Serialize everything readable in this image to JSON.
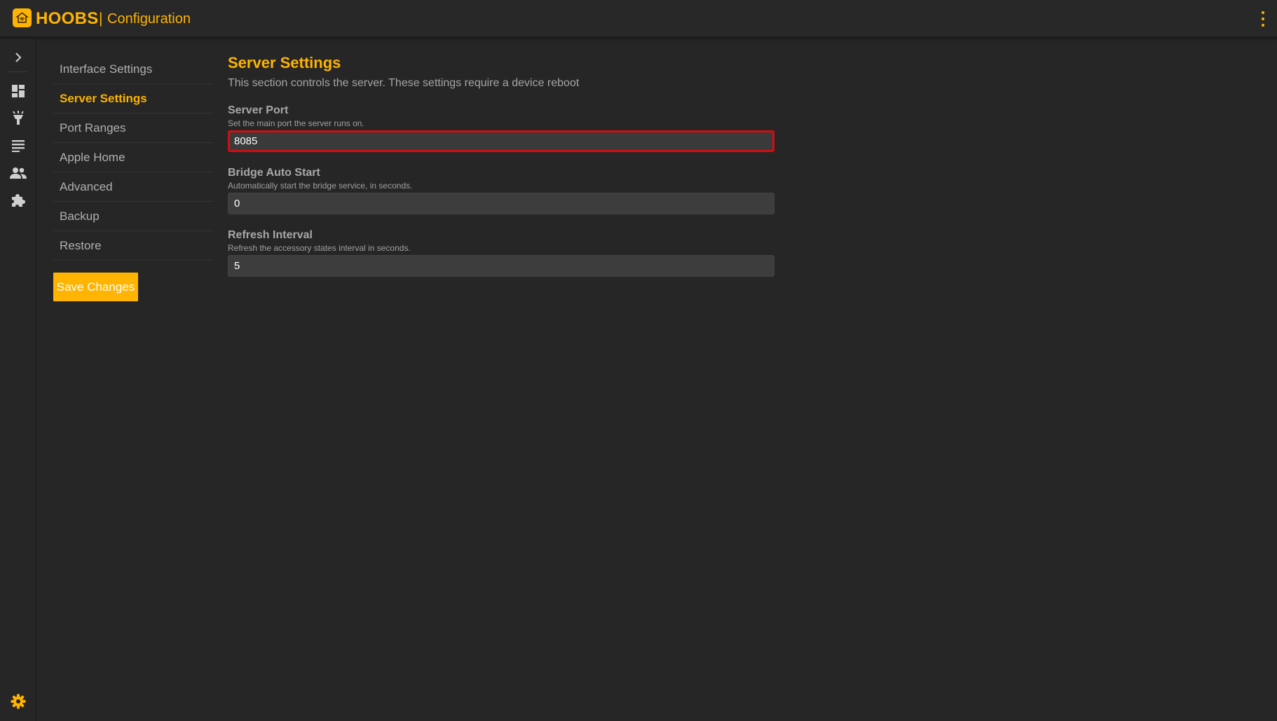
{
  "header": {
    "brand": "HOOBS",
    "separator": "|",
    "page": "Configuration",
    "logo_icon": "hoobs-logo-icon",
    "menu_icon": "kebab-menu-icon"
  },
  "rail": {
    "items": [
      {
        "icon": "chevron-right-icon"
      },
      {
        "icon": "dashboard-icon"
      },
      {
        "icon": "accessories-lamp-icon"
      },
      {
        "icon": "log-list-icon"
      },
      {
        "icon": "users-icon"
      },
      {
        "icon": "plugins-puzzle-icon"
      }
    ],
    "settings_icon": "gear-icon"
  },
  "subnav": {
    "items": [
      {
        "label": "Interface Settings"
      },
      {
        "label": "Server Settings",
        "active": true
      },
      {
        "label": "Port Ranges"
      },
      {
        "label": "Apple Home"
      },
      {
        "label": "Advanced"
      },
      {
        "label": "Backup"
      },
      {
        "label": "Restore"
      }
    ],
    "save_label": "Save Changes"
  },
  "main": {
    "title": "Server Settings",
    "description": "This section controls the server. These settings require a device reboot",
    "fields": [
      {
        "label": "Server Port",
        "help": "Set the main port the server runs on.",
        "value": "8085"
      },
      {
        "label": "Bridge Auto Start",
        "help": "Automatically start the bridge service, in seconds.",
        "value": "0"
      },
      {
        "label": "Refresh Interval",
        "help": "Refresh the accessory states interval in seconds.",
        "value": "5"
      }
    ]
  },
  "colors": {
    "accent": "#feb400",
    "background": "#262626",
    "highlight_border": "#d40d12"
  }
}
